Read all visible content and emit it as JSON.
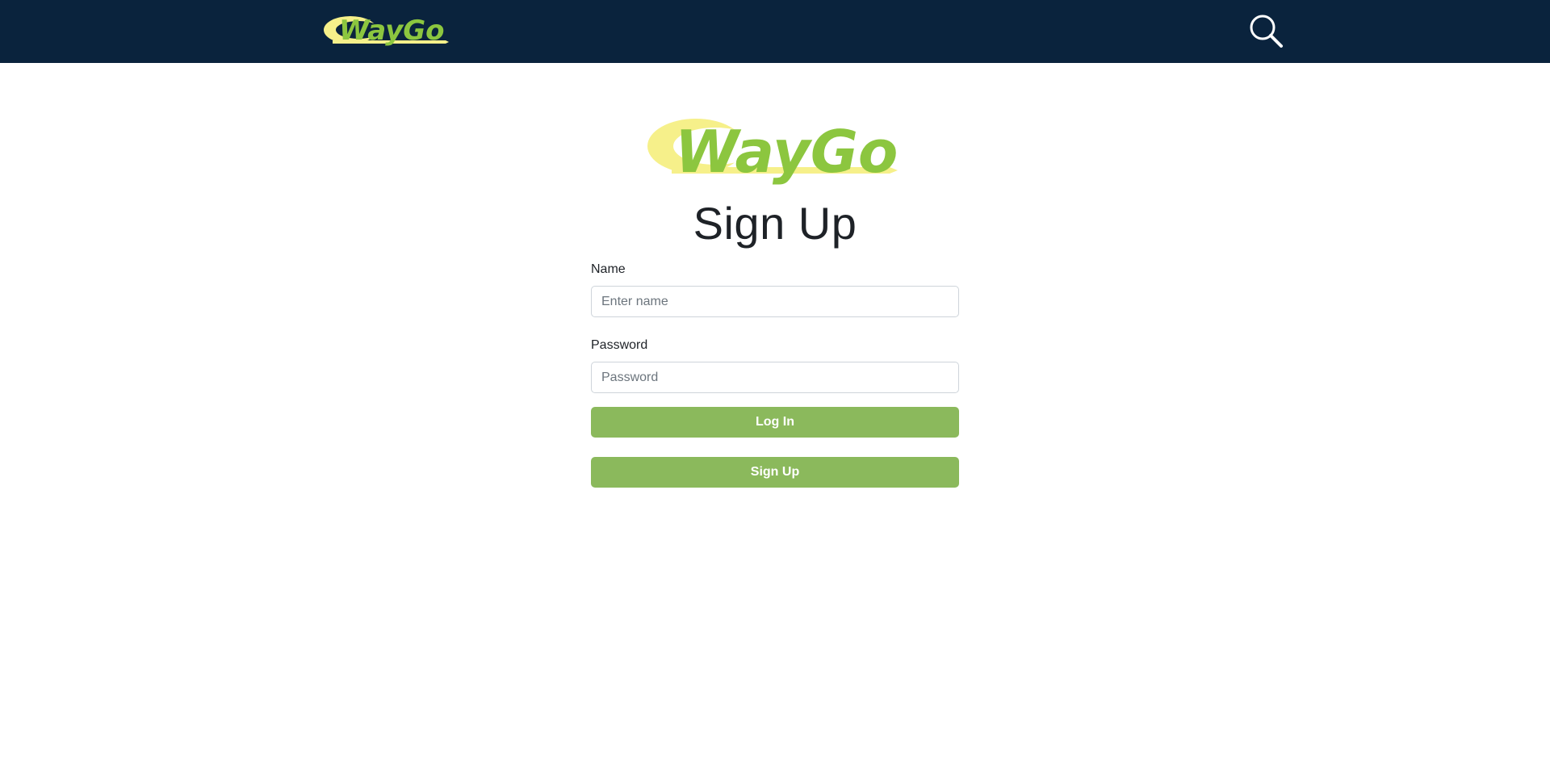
{
  "header": {
    "logo_text": "WayGo",
    "search_icon": "search-icon"
  },
  "main": {
    "logo_text": "WayGo",
    "title": "Sign Up",
    "form": {
      "name_label": "Name",
      "name_placeholder": "Enter name",
      "name_value": "",
      "password_label": "Password",
      "password_placeholder": "Password",
      "password_value": "",
      "login_label": "Log In",
      "signup_label": "Sign Up"
    }
  },
  "colors": {
    "header_bg": "#0a233d",
    "button_bg": "#8bb95c",
    "logo_green": "#8cc63f",
    "logo_yellow": "#f6f08a",
    "text": "#1e2227"
  }
}
